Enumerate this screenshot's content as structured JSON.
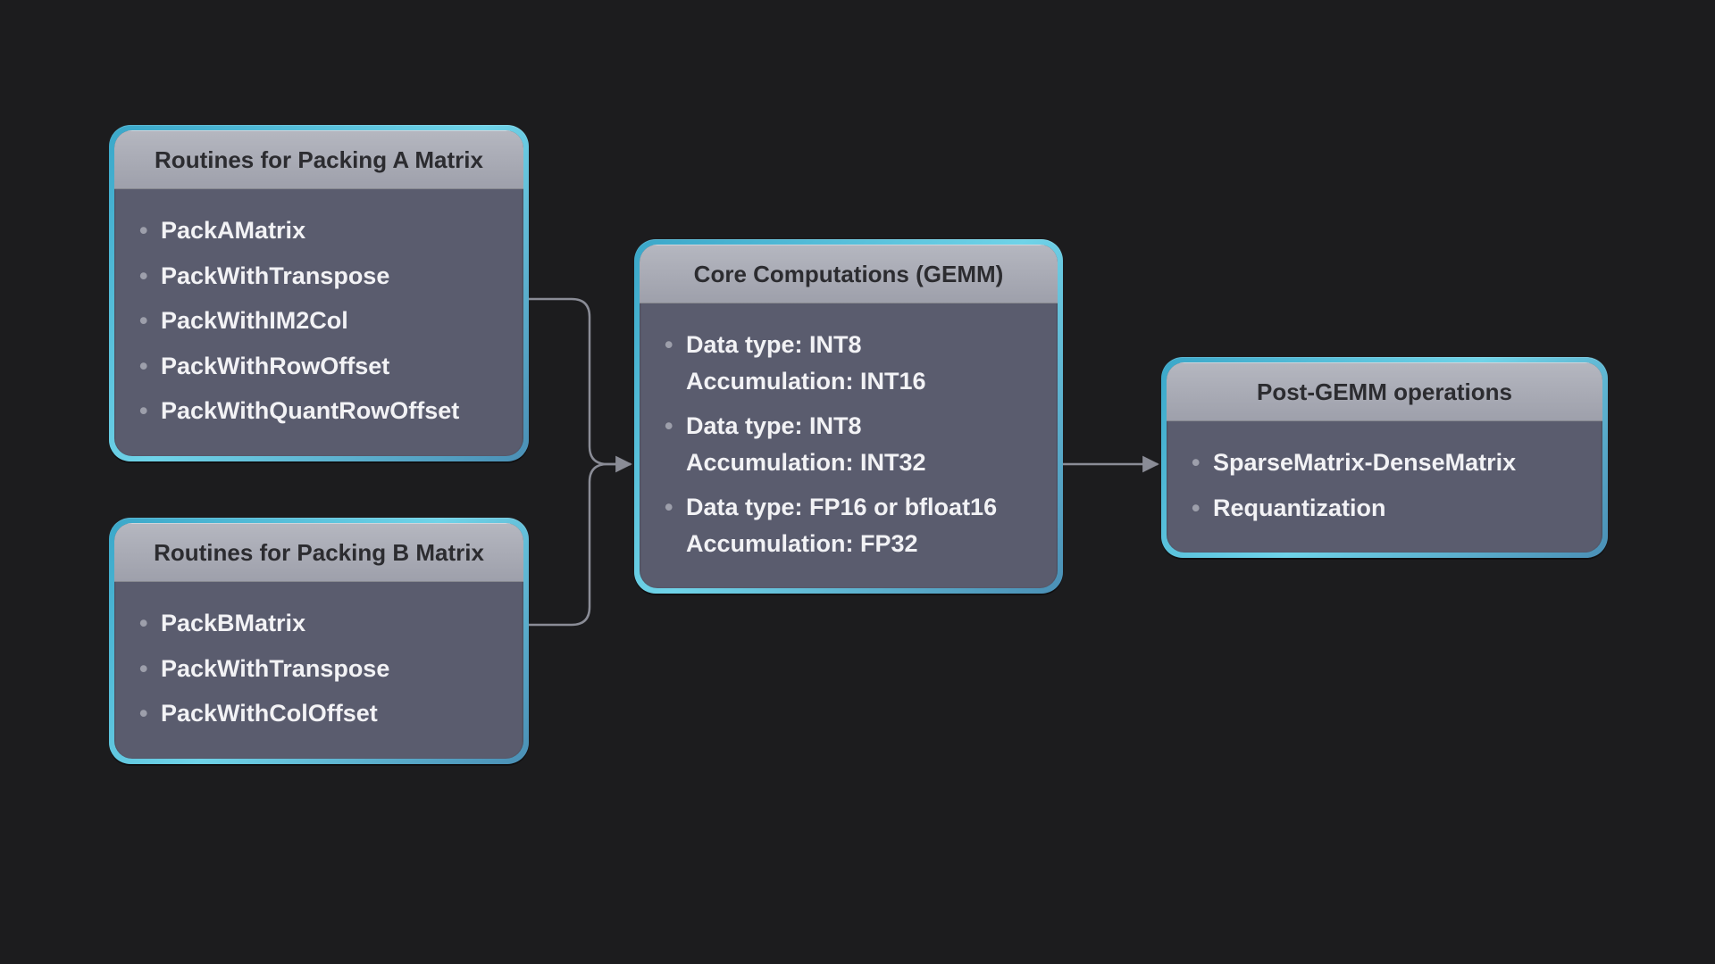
{
  "boxes": {
    "a": {
      "title": "Routines for Packing A Matrix",
      "items": [
        "PackAMatrix",
        "PackWithTranspose",
        "PackWithIM2Col",
        "PackWithRowOffset",
        "PackWithQuantRowOffset"
      ]
    },
    "b": {
      "title": "Routines for Packing B Matrix",
      "items": [
        "PackBMatrix",
        "PackWithTranspose",
        "PackWithColOffset"
      ]
    },
    "c": {
      "title": "Core Computations (GEMM)",
      "items": [
        {
          "line1": "Data type: INT8",
          "line2": "Accumulation: INT16"
        },
        {
          "line1": "Data type: INT8",
          "line2": "Accumulation: INT32"
        },
        {
          "line1": "Data type: FP16 or bfloat16",
          "line2": "Accumulation: FP32"
        }
      ]
    },
    "d": {
      "title": "Post-GEMM operations",
      "items": [
        "SparseMatrix-DenseMatrix",
        "Requantization"
      ]
    }
  }
}
